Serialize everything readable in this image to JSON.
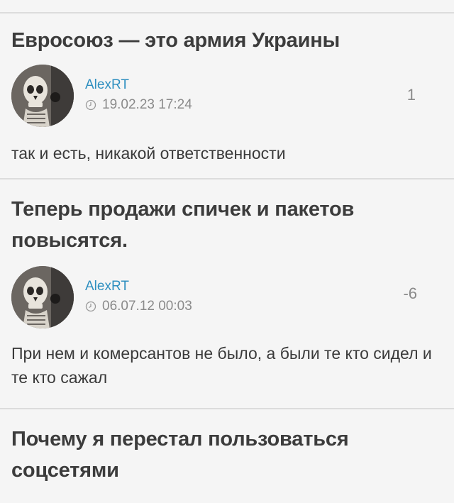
{
  "posts": [
    {
      "title": "Евросоюз — это армия Украины",
      "author": "AlexRT",
      "date": "19.02.23 17:24",
      "rating": "1",
      "comment": "так и есть, никакой ответственности"
    },
    {
      "title": "Теперь продажи спичек и пакетов повысятся.",
      "author": "AlexRT",
      "date": "06.07.12 00:03",
      "rating": "-6",
      "comment": "При нем и комерсантов не было, а были те кто сидел и те кто сажал"
    },
    {
      "title": "Почему я перестал пользоваться соцсетями"
    }
  ],
  "icons": {
    "avatar": "skull-avatar-icon",
    "date": "clock-icon"
  },
  "colors": {
    "background": "#f5f5f5",
    "author_link": "#2e8fc0",
    "muted": "#8a8a8a",
    "divider": "#dcdcdc",
    "title": "#3c3c3c"
  }
}
